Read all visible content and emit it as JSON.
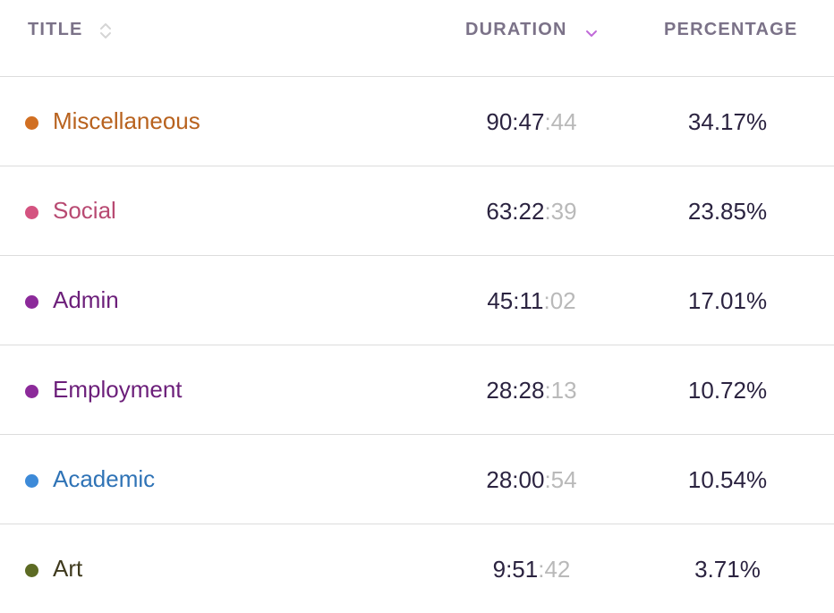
{
  "header": {
    "title_label": "TITLE",
    "duration_label": "DURATION",
    "percentage_label": "PERCENTAGE"
  },
  "colors": {
    "sort_active": "#c06ad8",
    "sort_inactive": "#d5d5d5"
  },
  "rows": [
    {
      "title": "Miscellaneous",
      "color": "#d16f22",
      "text_color": "#b8621e",
      "dur_main": "90:47",
      "dur_sec": ":44",
      "pct": "34.17%"
    },
    {
      "title": "Social",
      "color": "#d45380",
      "text_color": "#b84a72",
      "dur_main": "63:22",
      "dur_sec": ":39",
      "pct": "23.85%"
    },
    {
      "title": "Admin",
      "color": "#8c2a9a",
      "text_color": "#6c1f7a",
      "dur_main": "45:11",
      "dur_sec": ":02",
      "pct": "17.01%"
    },
    {
      "title": "Employment",
      "color": "#8c2a9a",
      "text_color": "#6c1f7a",
      "dur_main": "28:28",
      "dur_sec": ":13",
      "pct": "10.72%"
    },
    {
      "title": "Academic",
      "color": "#3d8ad8",
      "text_color": "#2f73b6",
      "dur_main": "28:00",
      "dur_sec": ":54",
      "pct": "10.54%"
    },
    {
      "title": "Art",
      "color": "#5d6b24",
      "text_color": "#3f3a1e",
      "dur_main": "9:51",
      "dur_sec": ":42",
      "pct": "3.71%"
    }
  ]
}
